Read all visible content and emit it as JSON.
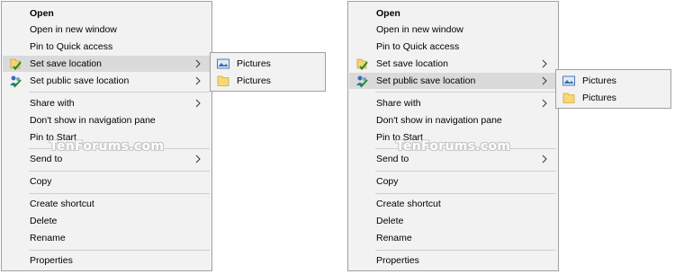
{
  "watermark": "TenForums.com",
  "left_menu": {
    "items": [
      {
        "label": "Open"
      },
      {
        "label": "Open in new window"
      },
      {
        "label": "Pin to Quick access"
      },
      {
        "label": "Set save location"
      },
      {
        "label": "Set public save location"
      },
      {
        "label": "Share with"
      },
      {
        "label": "Don't show in navigation pane"
      },
      {
        "label": "Pin to Start"
      },
      {
        "label": "Send to"
      },
      {
        "label": "Copy"
      },
      {
        "label": "Create shortcut"
      },
      {
        "label": "Delete"
      },
      {
        "label": "Rename"
      },
      {
        "label": "Properties"
      }
    ],
    "highlighted": "Set save location",
    "submenu": [
      {
        "label": "Pictures",
        "icon": "pictures-library-icon"
      },
      {
        "label": "Pictures",
        "icon": "folder-icon"
      }
    ]
  },
  "right_menu": {
    "items": [
      {
        "label": "Open"
      },
      {
        "label": "Open in new window"
      },
      {
        "label": "Pin to Quick access"
      },
      {
        "label": "Set save location"
      },
      {
        "label": "Set public save location"
      },
      {
        "label": "Share with"
      },
      {
        "label": "Don't show in navigation pane"
      },
      {
        "label": "Pin to Start"
      },
      {
        "label": "Send to"
      },
      {
        "label": "Copy"
      },
      {
        "label": "Create shortcut"
      },
      {
        "label": "Delete"
      },
      {
        "label": "Rename"
      },
      {
        "label": "Properties"
      }
    ],
    "highlighted": "Set public save location",
    "submenu": [
      {
        "label": "Pictures",
        "icon": "pictures-library-icon"
      },
      {
        "label": "Pictures",
        "icon": "folder-icon"
      }
    ]
  },
  "colors": {
    "menu_bg": "#f2f2f2",
    "highlight": "#dadada",
    "border": "#a0a0a0"
  }
}
